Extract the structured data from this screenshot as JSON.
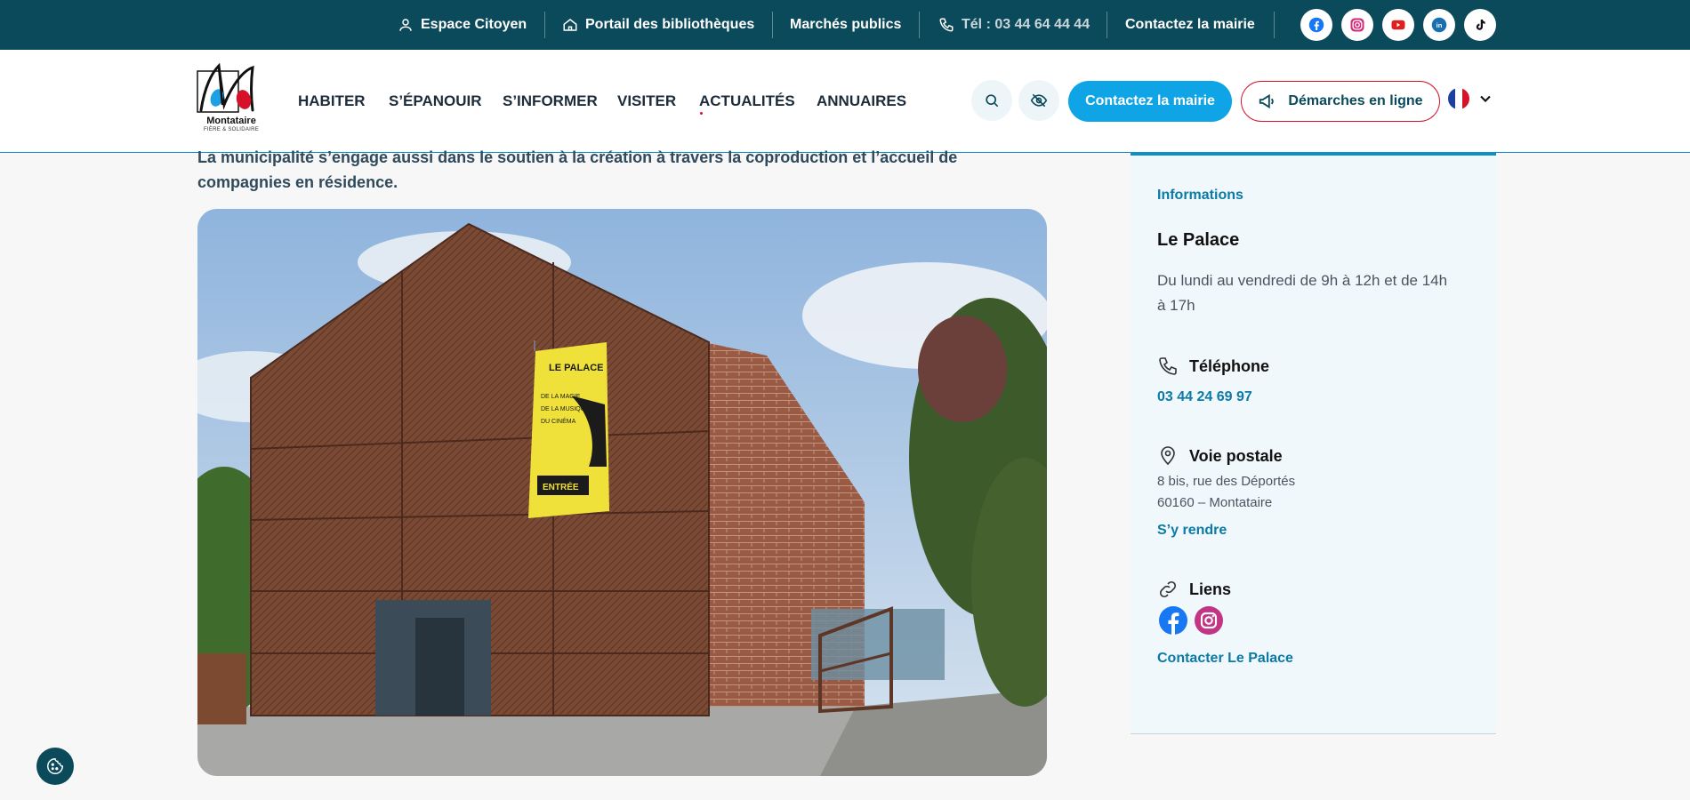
{
  "topbar": {
    "espace_citoyen": "Espace Citoyen",
    "portail": "Portail des bibliothèques",
    "marches": "Marchés publics",
    "tel": "Tél : 03 44 64 44 44",
    "contact": "Contactez la mairie",
    "socials": [
      "facebook-icon",
      "instagram-icon",
      "youtube-icon",
      "linkedin-icon",
      "tiktok-icon"
    ]
  },
  "logo": {
    "name": "Montataire",
    "tagline": "FIÈRE & SOLIDAIRE"
  },
  "nav": {
    "items": [
      "HABITER",
      "S’ÉPANOUIR",
      "S’INFORMER",
      "VISITER",
      "ACTUALITÉS",
      "ANNUAIRES"
    ]
  },
  "header": {
    "contact_button": "Contactez la mairie",
    "demarches_button": "Démarches en ligne",
    "language": "fr"
  },
  "main": {
    "intro_line1": "La municipalité s’engage aussi dans le soutien à la création à travers la coproduction et l’accueil de",
    "intro_line2": "compagnies en résidence.",
    "banner": {
      "title": "LE PALACE",
      "line1": "DE LA MAGIE",
      "line2": "DE LA MUSIQUE",
      "line3": "DU CINÉMA",
      "entry": "ENTRÉE"
    }
  },
  "sidebar": {
    "eyebrow": "Informations",
    "title": "Le Palace",
    "hours_line1": "Du lundi au vendredi de 9h à 12h et de 14h",
    "hours_line2": "à 17h",
    "phone_heading": "Téléphone",
    "phone": "03 44 24 69 97",
    "address_heading": "Voie postale",
    "address_line1": "8 bis, rue des Déportés",
    "address_line2": "60160 – Montataire",
    "directions": "S’y rendre",
    "links_heading": "Liens",
    "contact_link": "Contacter Le Palace"
  },
  "colors": {
    "topbar": "#0b4a5a",
    "accent_blue": "#0ea4e6",
    "accent_red": "#d6112a",
    "link_blue": "#0b7aa5",
    "sidebar_bg": "#f0f8fc"
  }
}
